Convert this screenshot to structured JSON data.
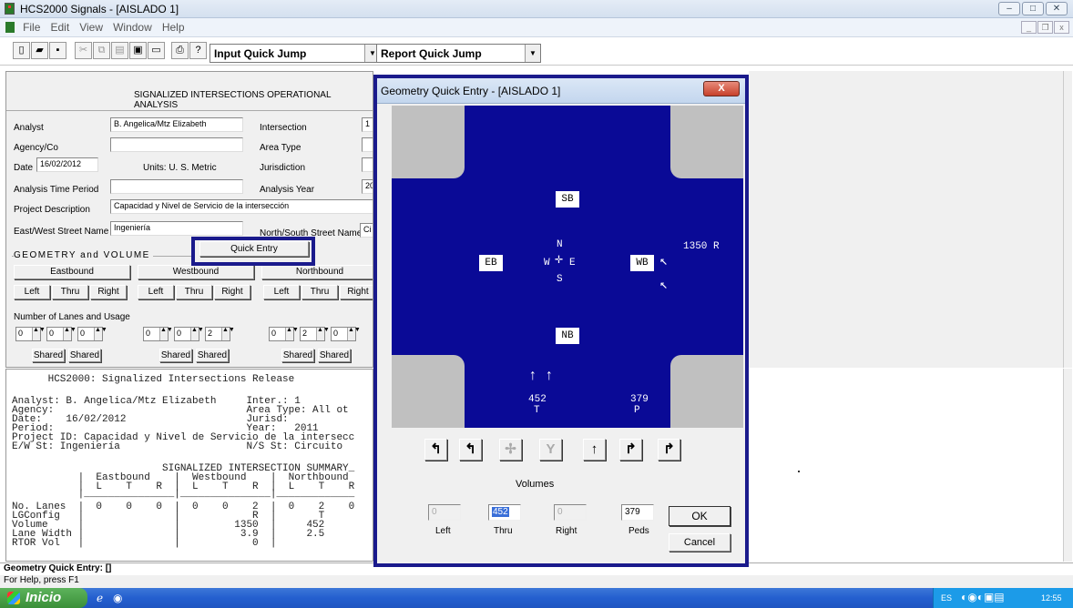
{
  "app": {
    "title": "HCS2000 Signals - [AISLADO 1]"
  },
  "menu": [
    "File",
    "Edit",
    "View",
    "Window",
    "Help"
  ],
  "toolbar": {
    "input_jump": "Input Quick Jump",
    "report_jump": "Report Quick Jump"
  },
  "form": {
    "header": "SIGNALIZED INTERSECTIONS OPERATIONAL ANALYSIS",
    "analyst_label": "Analyst",
    "analyst": "B. Angelica/Mtz Elizabeth",
    "intersection_label": "Intersection",
    "intersection": "1",
    "agency_label": "Agency/Co",
    "area_type_label": "Area Type",
    "date_label": "Date",
    "date": "16/02/2012",
    "units": "Units: U. S. Metric",
    "jurisdiction_label": "Jurisdiction",
    "period_label": "Analysis Time Period",
    "year_label": "Analysis Year",
    "year": "20",
    "project_label": "Project Description",
    "project": "Capacidad y Nivel de Servicio de la intersección",
    "ew_label": "East/West Street Name",
    "ew": "Ingeniería",
    "ns_label": "North/South Street Name",
    "ns": "Ci",
    "geometry_label": "GEOMETRY and VOLUME",
    "quick_entry": "Quick Entry",
    "approaches": [
      "Eastbound",
      "Westbound",
      "Northbound"
    ],
    "movements": [
      "Left",
      "Thru",
      "Right"
    ],
    "lanes_label": "Number of Lanes and Usage",
    "lanes": [
      [
        "0",
        "0",
        "0"
      ],
      [
        "0",
        "0",
        "2"
      ],
      [
        "0",
        "2",
        "0"
      ]
    ],
    "shared": "Shared"
  },
  "report": {
    "lines": [
      "      HCS2000: Signalized Intersections Release",
      "",
      "Analyst: B. Angelica/Mtz Elizabeth     Inter.: 1",
      "Agency:                                Area Type: All ot",
      "Date:    16/02/2012                    Jurisd:",
      "Period:                                Year:   2011",
      "Project ID: Capacidad y Nivel de Servicio de la intersecc",
      "E/W St: Ingeniería                     N/S St: Circuito",
      "",
      "                         SIGNALIZED INTERSECTION SUMMARY_",
      "           |  Eastbound    |  Westbound    |  Northbound",
      "           |  L    T    R  |  L    T    R  |  L    T    R",
      "           |_______________|_______________|_____________",
      "No. Lanes  |  0    0    0  |  0    0    2  |  0    2    0",
      "LGConfig   |               |            R  |       T",
      "Volume     |               |         1350  |     452",
      "Lane Width |               |          3.9  |     2.5",
      "RTOR Vol   |               |            0  |"
    ]
  },
  "status": {
    "line1": "Geometry Quick Entry: []",
    "line2": "For Help, press F1"
  },
  "taskbar": {
    "start": "Inicio",
    "lang": "ES",
    "clock": "12:55"
  },
  "dialog": {
    "title": "Geometry Quick Entry - [AISLADO 1]",
    "close": "X",
    "approaches": {
      "sb": "SB",
      "nb": "NB",
      "eb": "EB",
      "wb": "WB"
    },
    "compass": {
      "n": "N",
      "s": "S",
      "e": "E",
      "w": "W"
    },
    "wb_right_volume": "1350  R",
    "nb_thru_volume": "452",
    "nb_thru_label": "T",
    "nb_peds_volume": "379",
    "nb_peds_label": "P",
    "volumes_label": "Volumes",
    "left_label": "Left",
    "thru_label": "Thru",
    "right_label": "Right",
    "peds_label": "Peds",
    "left_value": "0",
    "thru_value": "452",
    "right_value": "0",
    "peds_value": "379",
    "ok": "OK",
    "cancel": "Cancel"
  }
}
